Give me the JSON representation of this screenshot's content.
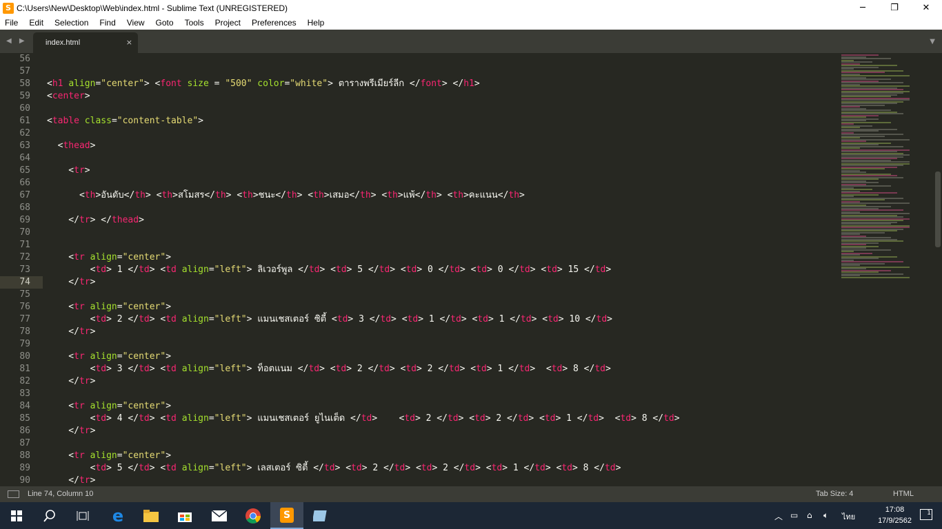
{
  "window": {
    "title": "C:\\Users\\New\\Desktop\\Web\\index.html - Sublime Text (UNREGISTERED)",
    "minimize": "─",
    "maximize": "❐",
    "close": "✕"
  },
  "menu": [
    "File",
    "Edit",
    "Selection",
    "Find",
    "View",
    "Goto",
    "Tools",
    "Project",
    "Preferences",
    "Help"
  ],
  "tabs": {
    "active_label": "index.html",
    "close_glyph": "×",
    "nav": "◀ ▶",
    "dropdown": "▼"
  },
  "editor": {
    "active_line": 74,
    "lines": [
      {
        "n": "56",
        "tokens": []
      },
      {
        "n": "57",
        "tokens": []
      },
      {
        "n": "58",
        "tokens": [
          [
            "tx",
            "<"
          ],
          [
            "tg",
            "h1"
          ],
          [
            "tx",
            " "
          ],
          [
            "at",
            "align"
          ],
          [
            "tx",
            "="
          ],
          [
            "st",
            "\"center\""
          ],
          [
            "tx",
            "> <"
          ],
          [
            "tg",
            "font"
          ],
          [
            "tx",
            " "
          ],
          [
            "at",
            "size"
          ],
          [
            "tx",
            " = "
          ],
          [
            "st",
            "\"500\""
          ],
          [
            "tx",
            " "
          ],
          [
            "at",
            "color"
          ],
          [
            "tx",
            "="
          ],
          [
            "st",
            "\"white\""
          ],
          [
            "tx",
            "> ตารางพรีเมียร์ลีก </"
          ],
          [
            "tg",
            "font"
          ],
          [
            "tx",
            "> </"
          ],
          [
            "tg",
            "h1"
          ],
          [
            "tx",
            ">"
          ]
        ]
      },
      {
        "n": "59",
        "tokens": [
          [
            "tx",
            "<"
          ],
          [
            "tg",
            "center"
          ],
          [
            "tx",
            ">"
          ]
        ]
      },
      {
        "n": "60",
        "tokens": []
      },
      {
        "n": "61",
        "tokens": [
          [
            "tx",
            "<"
          ],
          [
            "tg",
            "table"
          ],
          [
            "tx",
            " "
          ],
          [
            "at",
            "class"
          ],
          [
            "tx",
            "="
          ],
          [
            "st",
            "\"content-table\""
          ],
          [
            "tx",
            ">"
          ]
        ]
      },
      {
        "n": "62",
        "tokens": []
      },
      {
        "n": "63",
        "tokens": [
          [
            "tx",
            "  <"
          ],
          [
            "tg",
            "thead"
          ],
          [
            "tx",
            ">"
          ]
        ]
      },
      {
        "n": "64",
        "tokens": []
      },
      {
        "n": "65",
        "tokens": [
          [
            "tx",
            "    <"
          ],
          [
            "tg",
            "tr"
          ],
          [
            "tx",
            ">"
          ]
        ]
      },
      {
        "n": "66",
        "tokens": []
      },
      {
        "n": "67",
        "tokens": [
          [
            "tx",
            "      <"
          ],
          [
            "tg",
            "th"
          ],
          [
            "tx",
            ">อันดับ</"
          ],
          [
            "tg",
            "th"
          ],
          [
            "tx",
            "> <"
          ],
          [
            "tg",
            "th"
          ],
          [
            "tx",
            ">สโมสร</"
          ],
          [
            "tg",
            "th"
          ],
          [
            "tx",
            "> <"
          ],
          [
            "tg",
            "th"
          ],
          [
            "tx",
            ">ชนะ</"
          ],
          [
            "tg",
            "th"
          ],
          [
            "tx",
            "> <"
          ],
          [
            "tg",
            "th"
          ],
          [
            "tx",
            ">เสมอ</"
          ],
          [
            "tg",
            "th"
          ],
          [
            "tx",
            "> <"
          ],
          [
            "tg",
            "th"
          ],
          [
            "tx",
            ">แพ้</"
          ],
          [
            "tg",
            "th"
          ],
          [
            "tx",
            "> <"
          ],
          [
            "tg",
            "th"
          ],
          [
            "tx",
            ">คะแนน</"
          ],
          [
            "tg",
            "th"
          ],
          [
            "tx",
            ">"
          ]
        ]
      },
      {
        "n": "68",
        "tokens": []
      },
      {
        "n": "69",
        "tokens": [
          [
            "tx",
            "    </"
          ],
          [
            "tg",
            "tr"
          ],
          [
            "tx",
            "> </"
          ],
          [
            "tg",
            "thead"
          ],
          [
            "tx",
            ">"
          ]
        ]
      },
      {
        "n": "70",
        "tokens": []
      },
      {
        "n": "71",
        "tokens": []
      },
      {
        "n": "72",
        "tokens": [
          [
            "tx",
            "    <"
          ],
          [
            "tg",
            "tr"
          ],
          [
            "tx",
            " "
          ],
          [
            "at",
            "align"
          ],
          [
            "tx",
            "="
          ],
          [
            "st",
            "\"center\""
          ],
          [
            "tx",
            ">"
          ]
        ]
      },
      {
        "n": "73",
        "tokens": [
          [
            "tx",
            "        <"
          ],
          [
            "tg",
            "td"
          ],
          [
            "tx",
            "> 1 </"
          ],
          [
            "tg",
            "td"
          ],
          [
            "tx",
            "> <"
          ],
          [
            "tg",
            "td"
          ],
          [
            "tx",
            " "
          ],
          [
            "at",
            "align"
          ],
          [
            "tx",
            "="
          ],
          [
            "st",
            "\"left\""
          ],
          [
            "tx",
            "> ลิเวอร์พูล </"
          ],
          [
            "tg",
            "td"
          ],
          [
            "tx",
            "> <"
          ],
          [
            "tg",
            "td"
          ],
          [
            "tx",
            "> 5 </"
          ],
          [
            "tg",
            "td"
          ],
          [
            "tx",
            "> <"
          ],
          [
            "tg",
            "td"
          ],
          [
            "tx",
            "> 0 </"
          ],
          [
            "tg",
            "td"
          ],
          [
            "tx",
            "> <"
          ],
          [
            "tg",
            "td"
          ],
          [
            "tx",
            "> 0 </"
          ],
          [
            "tg",
            "td"
          ],
          [
            "tx",
            "> <"
          ],
          [
            "tg",
            "td"
          ],
          [
            "tx",
            "> 15 </"
          ],
          [
            "tg",
            "td"
          ],
          [
            "tx",
            ">"
          ]
        ]
      },
      {
        "n": "74",
        "tokens": [
          [
            "tx",
            "    </"
          ],
          [
            "tg",
            "tr"
          ],
          [
            "tx",
            ">"
          ]
        ]
      },
      {
        "n": "75",
        "tokens": []
      },
      {
        "n": "76",
        "tokens": [
          [
            "tx",
            "    <"
          ],
          [
            "tg",
            "tr"
          ],
          [
            "tx",
            " "
          ],
          [
            "at",
            "align"
          ],
          [
            "tx",
            "="
          ],
          [
            "st",
            "\"center\""
          ],
          [
            "tx",
            ">"
          ]
        ]
      },
      {
        "n": "77",
        "tokens": [
          [
            "tx",
            "        <"
          ],
          [
            "tg",
            "td"
          ],
          [
            "tx",
            "> 2 </"
          ],
          [
            "tg",
            "td"
          ],
          [
            "tx",
            "> <"
          ],
          [
            "tg",
            "td"
          ],
          [
            "tx",
            " "
          ],
          [
            "at",
            "align"
          ],
          [
            "tx",
            "="
          ],
          [
            "st",
            "\"left\""
          ],
          [
            "tx",
            "> แมนเชสเตอร์ ซิตี้ <"
          ],
          [
            "tg",
            "td"
          ],
          [
            "tx",
            "> 3 </"
          ],
          [
            "tg",
            "td"
          ],
          [
            "tx",
            "> <"
          ],
          [
            "tg",
            "td"
          ],
          [
            "tx",
            "> 1 </"
          ],
          [
            "tg",
            "td"
          ],
          [
            "tx",
            "> <"
          ],
          [
            "tg",
            "td"
          ],
          [
            "tx",
            "> 1 </"
          ],
          [
            "tg",
            "td"
          ],
          [
            "tx",
            "> <"
          ],
          [
            "tg",
            "td"
          ],
          [
            "tx",
            "> 10 </"
          ],
          [
            "tg",
            "td"
          ],
          [
            "tx",
            ">"
          ]
        ]
      },
      {
        "n": "78",
        "tokens": [
          [
            "tx",
            "    </"
          ],
          [
            "tg",
            "tr"
          ],
          [
            "tx",
            ">"
          ]
        ]
      },
      {
        "n": "79",
        "tokens": []
      },
      {
        "n": "80",
        "tokens": [
          [
            "tx",
            "    <"
          ],
          [
            "tg",
            "tr"
          ],
          [
            "tx",
            " "
          ],
          [
            "at",
            "align"
          ],
          [
            "tx",
            "="
          ],
          [
            "st",
            "\"center\""
          ],
          [
            "tx",
            ">"
          ]
        ]
      },
      {
        "n": "81",
        "tokens": [
          [
            "tx",
            "        <"
          ],
          [
            "tg",
            "td"
          ],
          [
            "tx",
            "> 3 </"
          ],
          [
            "tg",
            "td"
          ],
          [
            "tx",
            "> <"
          ],
          [
            "tg",
            "td"
          ],
          [
            "tx",
            " "
          ],
          [
            "at",
            "align"
          ],
          [
            "tx",
            "="
          ],
          [
            "st",
            "\"left\""
          ],
          [
            "tx",
            "> ท็อตแนม </"
          ],
          [
            "tg",
            "td"
          ],
          [
            "tx",
            "> <"
          ],
          [
            "tg",
            "td"
          ],
          [
            "tx",
            "> 2 </"
          ],
          [
            "tg",
            "td"
          ],
          [
            "tx",
            "> <"
          ],
          [
            "tg",
            "td"
          ],
          [
            "tx",
            "> 2 </"
          ],
          [
            "tg",
            "td"
          ],
          [
            "tx",
            "> <"
          ],
          [
            "tg",
            "td"
          ],
          [
            "tx",
            "> 1 </"
          ],
          [
            "tg",
            "td"
          ],
          [
            "tx",
            ">  <"
          ],
          [
            "tg",
            "td"
          ],
          [
            "tx",
            "> 8 </"
          ],
          [
            "tg",
            "td"
          ],
          [
            "tx",
            ">"
          ]
        ]
      },
      {
        "n": "82",
        "tokens": [
          [
            "tx",
            "    </"
          ],
          [
            "tg",
            "tr"
          ],
          [
            "tx",
            ">"
          ]
        ]
      },
      {
        "n": "83",
        "tokens": []
      },
      {
        "n": "84",
        "tokens": [
          [
            "tx",
            "    <"
          ],
          [
            "tg",
            "tr"
          ],
          [
            "tx",
            " "
          ],
          [
            "at",
            "align"
          ],
          [
            "tx",
            "="
          ],
          [
            "st",
            "\"center\""
          ],
          [
            "tx",
            ">"
          ]
        ]
      },
      {
        "n": "85",
        "tokens": [
          [
            "tx",
            "        <"
          ],
          [
            "tg",
            "td"
          ],
          [
            "tx",
            "> 4 </"
          ],
          [
            "tg",
            "td"
          ],
          [
            "tx",
            "> <"
          ],
          [
            "tg",
            "td"
          ],
          [
            "tx",
            " "
          ],
          [
            "at",
            "align"
          ],
          [
            "tx",
            "="
          ],
          [
            "st",
            "\"left\""
          ],
          [
            "tx",
            "> แมนเชสเตอร์ ยูไนเต็ด </"
          ],
          [
            "tg",
            "td"
          ],
          [
            "tx",
            ">    <"
          ],
          [
            "tg",
            "td"
          ],
          [
            "tx",
            "> 2 </"
          ],
          [
            "tg",
            "td"
          ],
          [
            "tx",
            "> <"
          ],
          [
            "tg",
            "td"
          ],
          [
            "tx",
            "> 2 </"
          ],
          [
            "tg",
            "td"
          ],
          [
            "tx",
            "> <"
          ],
          [
            "tg",
            "td"
          ],
          [
            "tx",
            "> 1 </"
          ],
          [
            "tg",
            "td"
          ],
          [
            "tx",
            ">  <"
          ],
          [
            "tg",
            "td"
          ],
          [
            "tx",
            "> 8 </"
          ],
          [
            "tg",
            "td"
          ],
          [
            "tx",
            ">"
          ]
        ]
      },
      {
        "n": "86",
        "tokens": [
          [
            "tx",
            "    </"
          ],
          [
            "tg",
            "tr"
          ],
          [
            "tx",
            ">"
          ]
        ]
      },
      {
        "n": "87",
        "tokens": []
      },
      {
        "n": "88",
        "tokens": [
          [
            "tx",
            "    <"
          ],
          [
            "tg",
            "tr"
          ],
          [
            "tx",
            " "
          ],
          [
            "at",
            "align"
          ],
          [
            "tx",
            "="
          ],
          [
            "st",
            "\"center\""
          ],
          [
            "tx",
            ">"
          ]
        ]
      },
      {
        "n": "89",
        "tokens": [
          [
            "tx",
            "        <"
          ],
          [
            "tg",
            "td"
          ],
          [
            "tx",
            "> 5 </"
          ],
          [
            "tg",
            "td"
          ],
          [
            "tx",
            "> <"
          ],
          [
            "tg",
            "td"
          ],
          [
            "tx",
            " "
          ],
          [
            "at",
            "align"
          ],
          [
            "tx",
            "="
          ],
          [
            "st",
            "\"left\""
          ],
          [
            "tx",
            "> เลสเตอร์ ซิตี้ </"
          ],
          [
            "tg",
            "td"
          ],
          [
            "tx",
            "> <"
          ],
          [
            "tg",
            "td"
          ],
          [
            "tx",
            "> 2 </"
          ],
          [
            "tg",
            "td"
          ],
          [
            "tx",
            "> <"
          ],
          [
            "tg",
            "td"
          ],
          [
            "tx",
            "> 2 </"
          ],
          [
            "tg",
            "td"
          ],
          [
            "tx",
            "> <"
          ],
          [
            "tg",
            "td"
          ],
          [
            "tx",
            "> 1 </"
          ],
          [
            "tg",
            "td"
          ],
          [
            "tx",
            "> <"
          ],
          [
            "tg",
            "td"
          ],
          [
            "tx",
            "> 8 </"
          ],
          [
            "tg",
            "td"
          ],
          [
            "tx",
            ">"
          ]
        ]
      },
      {
        "n": "90",
        "tokens": [
          [
            "tx",
            "    </"
          ],
          [
            "tg",
            "tr"
          ],
          [
            "tx",
            ">"
          ]
        ]
      }
    ]
  },
  "status": {
    "position": "Line 74, Column 10",
    "tab_size": "Tab Size: 4",
    "syntax": "HTML"
  },
  "taskbar": {
    "lang": "ไทย",
    "time": "17:08",
    "date": "17/9/2562",
    "notifications": "1"
  },
  "colors": {
    "background": "#272822",
    "tag": "#f92672",
    "attribute": "#a6e22e",
    "string": "#e6db74",
    "text": "#f8f8f2"
  }
}
